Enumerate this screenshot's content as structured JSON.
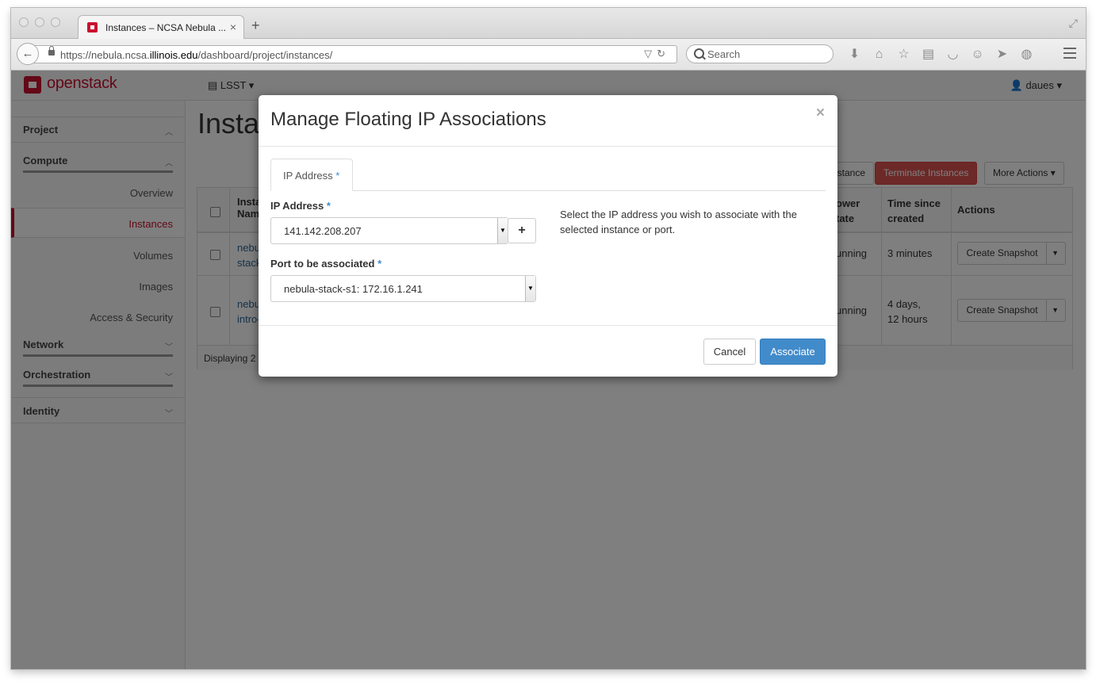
{
  "browser": {
    "tab_title": "Instances – NCSA Nebula ...",
    "url_prefix": "https://nebula.ncsa.",
    "url_domain": "illinois.edu",
    "url_suffix": "/dashboard/project/instances/",
    "search_placeholder": "Search"
  },
  "header": {
    "brand": "openstack",
    "project_selector": "LSST",
    "user_menu": "daues"
  },
  "sidebar": {
    "sections": [
      {
        "label": "Project"
      },
      {
        "label": "Compute"
      },
      {
        "label": "Network"
      },
      {
        "label": "Orchestration"
      },
      {
        "label": "Identity"
      }
    ],
    "compute_items": [
      {
        "label": "Overview"
      },
      {
        "label": "Instances"
      },
      {
        "label": "Volumes"
      },
      {
        "label": "Images"
      },
      {
        "label": "Access & Security"
      }
    ]
  },
  "main": {
    "page_title_partial": "Insta",
    "actions": {
      "launch_partial": "stance",
      "terminate": "Terminate Instances",
      "more": "More Actions"
    },
    "table": {
      "headers": {
        "name_partial_1": "Insta",
        "name_partial_2": "Nam",
        "power_1": "ower",
        "power_2": "tate",
        "time_1": "Time since",
        "time_2": "created",
        "actions": "Actions"
      },
      "rows": [
        {
          "name_1": "nebu",
          "name_2": "stack",
          "power": "unning",
          "time_1": "3 minutes",
          "time_2": "",
          "action": "Create Snapshot"
        },
        {
          "name_1": "nebu",
          "name_2": "intro-",
          "power": "unning",
          "time_1": "4 days,",
          "time_2": "12 hours",
          "action": "Create Snapshot"
        }
      ],
      "footer_partial": "Displaying 2 it"
    }
  },
  "modal": {
    "title": "Manage Floating IP Associations",
    "close": "×",
    "tab_label": "IP Address",
    "required_mark": "*",
    "ip_label": "IP Address",
    "ip_value": "141.142.208.207",
    "plus": "+",
    "port_label": "Port to be associated",
    "port_value": "nebula-stack-s1: 172.16.1.241",
    "help_text": "Select the IP address you wish to associate with the selected instance or port.",
    "cancel": "Cancel",
    "associate": "Associate"
  },
  "colors": {
    "accent": "#c8102e",
    "primary": "#428bca",
    "danger": "#d9534f"
  }
}
